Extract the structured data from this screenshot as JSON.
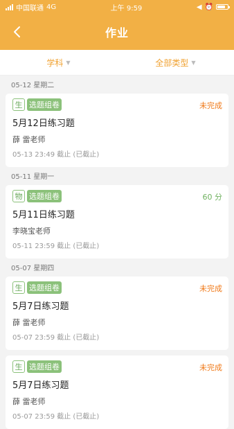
{
  "status_bar": {
    "carrier": "中国联通",
    "network": "4G",
    "time": "上午 9:59"
  },
  "nav": {
    "title": "作业"
  },
  "filters": [
    {
      "label": "学科"
    },
    {
      "label": "全部类型"
    }
  ],
  "groups": [
    {
      "date": "05-12 星期二",
      "subject": "生",
      "type": "选题组卷",
      "status": "未完成",
      "title": "5月12日练习题",
      "teacher": "薛 雷老师",
      "deadline": "05-13 23:49 截止 (已截止)"
    },
    {
      "date": "05-11 星期一",
      "subject": "物",
      "type": "选题组卷",
      "status": "60 分",
      "title": "5月11日练习题",
      "teacher": "李晓宝老师",
      "deadline": "05-11 23:59 截止 (已截止)"
    },
    {
      "date": "05-07 星期四",
      "subject": "生",
      "type": "选题组卷",
      "status": "未完成",
      "title": "5月7日练习题",
      "teacher": "薛 雷老师",
      "deadline": "05-07 23:59 截止 (已截止)"
    },
    {
      "subject": "生",
      "type": "选题组卷",
      "status": "未完成",
      "title": "5月7日练习题",
      "teacher": "薛 雷老师",
      "deadline": "05-07 23:59 截止 (已截止)"
    }
  ],
  "colors": {
    "header": "#f2b045",
    "accent": "#f0a232",
    "tag_green": "#8bc17a",
    "pending": "#f07a1a",
    "score": "#6fb15f"
  }
}
